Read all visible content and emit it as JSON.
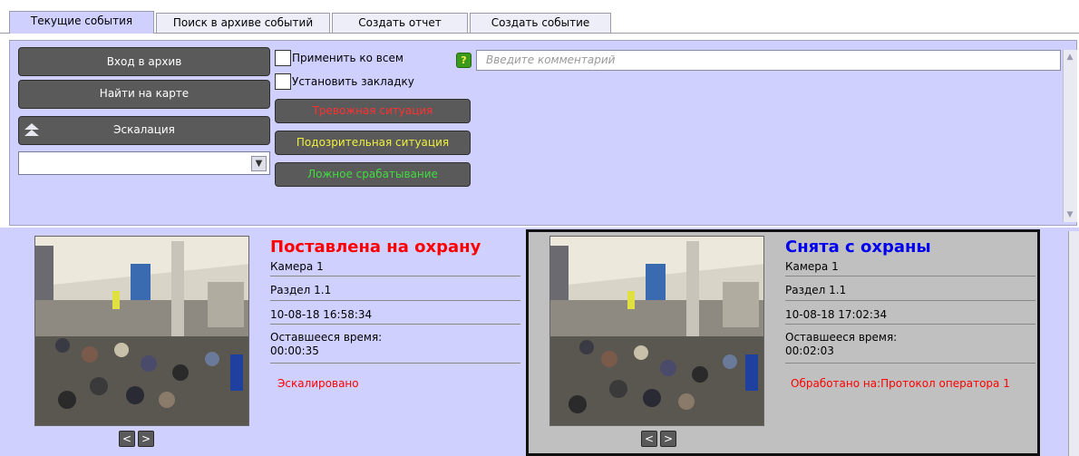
{
  "tabs": [
    {
      "label": "Текущие события",
      "active": true
    },
    {
      "label": "Поиск в архиве событий",
      "active": false
    },
    {
      "label": "Создать отчет",
      "active": false
    },
    {
      "label": "Создать событие",
      "active": false
    }
  ],
  "controls": {
    "archive_button": "Вход в архив",
    "map_button": "Найти на карте",
    "escalation_button": "Эскалация",
    "escalation_select_value": "",
    "apply_all_label": "Применить ко всем",
    "bookmark_label": "Установить закладку",
    "help_label": "?",
    "comment_placeholder": "Введите комментарий",
    "alarm_button": "Тревожная ситуация",
    "suspicious_button": "Подозрительная ситуация",
    "false_button": "Ложное срабатывание"
  },
  "colors": {
    "panel_bg": "#d0d0ff",
    "alarm_text": "#ff3030",
    "suspicious_text": "#f0f040",
    "false_text": "#40dd40",
    "armed_title": "#ff0000",
    "disarmed_title": "#0000ee",
    "status_text": "#ff0000"
  },
  "events": [
    {
      "title": "Поставлена на охрану",
      "camera": "Камера 1",
      "section": "Раздел 1.1",
      "datetime": "10-08-18 16:58:34",
      "remaining_label": "Оставшееся время:",
      "remaining_value": "00:00:35",
      "status": "Эскалировано",
      "nav_prev": "<",
      "nav_next": ">"
    },
    {
      "title": "Снята с охраны",
      "camera": "Камера 1",
      "section": "Раздел 1.1",
      "datetime": "10-08-18 17:02:34",
      "remaining_label": "Оставшееся время:",
      "remaining_value": "00:02:03",
      "status": "Обработано на:Протокол оператора 1",
      "nav_prev": "<",
      "nav_next": ">"
    }
  ]
}
